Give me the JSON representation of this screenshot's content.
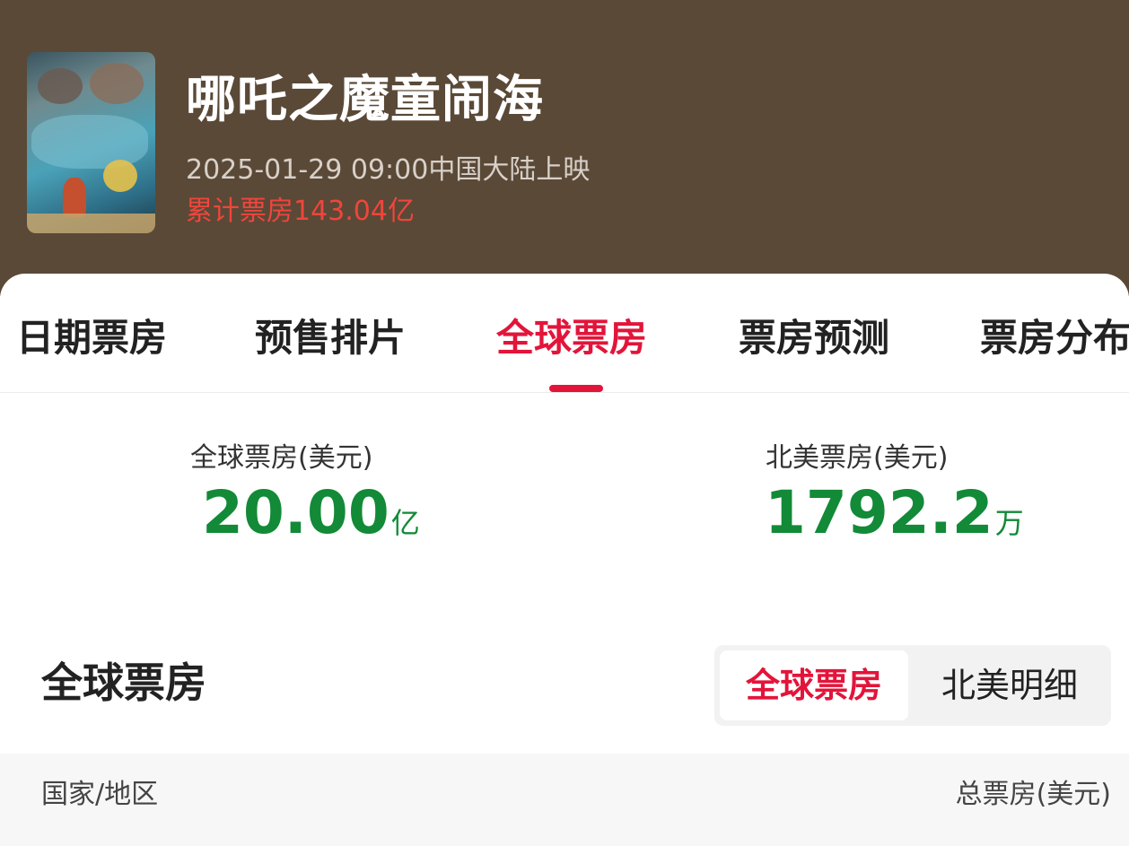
{
  "movie": {
    "title": "哪吒之魔童闹海",
    "release": "2025-01-29 09:00中国大陆上映",
    "total_box_office": "累计票房143.04亿"
  },
  "tabs": [
    {
      "label": "日期票房",
      "active": false
    },
    {
      "label": "预售排片",
      "active": false
    },
    {
      "label": "全球票房",
      "active": true
    },
    {
      "label": "票房预测",
      "active": false
    },
    {
      "label": "票房分布",
      "active": false
    }
  ],
  "stats": {
    "global": {
      "label": "全球票房(美元)",
      "value": "20.00",
      "unit": "亿"
    },
    "north_america": {
      "label": "北美票房(美元)",
      "value": "1792.2",
      "unit": "万"
    }
  },
  "section": {
    "title": "全球票房",
    "toggle": [
      {
        "label": "全球票房",
        "active": true
      },
      {
        "label": "北美明细",
        "active": false
      }
    ]
  },
  "table": {
    "columns": [
      "国家/地区",
      "总票房(美元)"
    ]
  },
  "colors": {
    "header_bg": "#5a4937",
    "accent_red": "#e3143a",
    "value_green": "#128a37",
    "total_red": "#f0453c"
  }
}
